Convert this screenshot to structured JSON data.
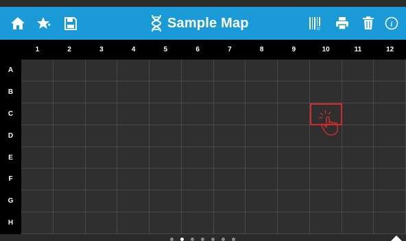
{
  "header": {
    "title": "Sample Map",
    "background_color": "#1a9ad6",
    "left_icons": [
      "home-icon",
      "favorite-star-icon",
      "save-icon"
    ],
    "title_icon": "dna-icon",
    "right_icons": [
      "barcode-icon",
      "print-icon",
      "delete-icon",
      "info-icon"
    ]
  },
  "grid": {
    "columns": [
      "1",
      "2",
      "3",
      "4",
      "5",
      "6",
      "7",
      "8",
      "9",
      "10",
      "11",
      "12"
    ],
    "rows": [
      "A",
      "B",
      "C",
      "D",
      "E",
      "F",
      "G",
      "H"
    ],
    "highlight": {
      "row": "C",
      "column": "10",
      "color": "#d42a2a",
      "icon": "tap-hand-icon"
    }
  },
  "pager": {
    "count": 7,
    "active_index": 1
  }
}
